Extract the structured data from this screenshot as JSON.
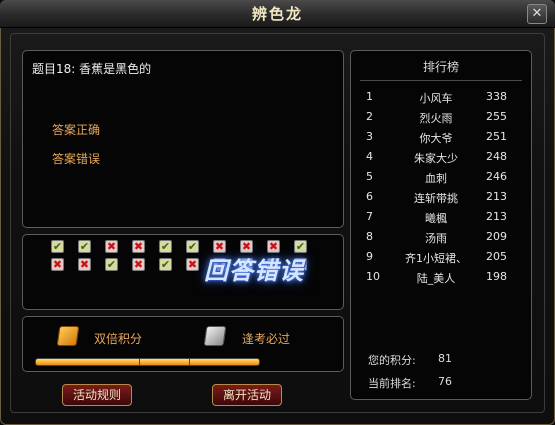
{
  "window": {
    "title": "辨色龙",
    "close_label": "✕"
  },
  "question": {
    "text": "题目18: 香蕉是黑色的"
  },
  "answers": [
    {
      "label": "答案正确"
    },
    {
      "label": "答案错误"
    }
  ],
  "answer_grid": {
    "rows": [
      [
        "ok",
        "ok",
        "bad",
        "bad",
        "ok",
        "ok",
        "bad",
        "bad",
        "bad",
        "ok"
      ],
      [
        "bad",
        "bad",
        "ok",
        "bad",
        "ok",
        "bad",
        "bad",
        "ok",
        "bad",
        "bad"
      ]
    ]
  },
  "banner_text": "回答错误",
  "bonuses": [
    {
      "label": "双倍积分",
      "icon": "gold-bonus-icon"
    },
    {
      "label": "逢考必过",
      "icon": "silver-bonus-icon"
    }
  ],
  "progress": {
    "value": 1.0,
    "segments": 3
  },
  "buttons": {
    "rules": "活动规则",
    "leave": "离开活动"
  },
  "leaderboard": {
    "title": "排行榜",
    "rows": [
      {
        "rank": "1",
        "name": "小风车",
        "score": "338"
      },
      {
        "rank": "2",
        "name": "烈火雨",
        "score": "255"
      },
      {
        "rank": "3",
        "name": "你大爷",
        "score": "251"
      },
      {
        "rank": "4",
        "name": "朱家大少",
        "score": "248"
      },
      {
        "rank": "5",
        "name": "血刺",
        "score": "246"
      },
      {
        "rank": "6",
        "name": "连斩带挑",
        "score": "213"
      },
      {
        "rank": "7",
        "name": "曦楓",
        "score": "213"
      },
      {
        "rank": "8",
        "name": "汤雨",
        "score": "209"
      },
      {
        "rank": "9",
        "name": "齐1小短裙、",
        "score": "205"
      },
      {
        "rank": "10",
        "name": "陆_美人",
        "score": "198"
      }
    ]
  },
  "my_stats": {
    "score_label": "您的积分:",
    "score_value": "81",
    "rank_label": "当前排名:",
    "rank_value": "76"
  },
  "colors": {
    "accent_orange": "#e8a65a",
    "ok_green": "#2e6a1c",
    "bad_red": "#cc1111"
  }
}
